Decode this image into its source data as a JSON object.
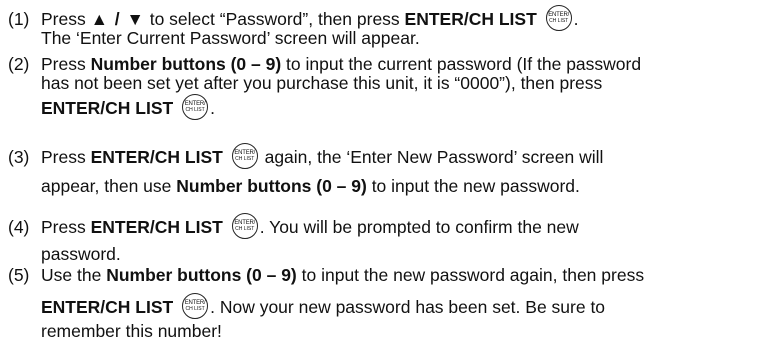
{
  "button": {
    "line1": "ENTER/",
    "line2": "CH LIST"
  },
  "steps": [
    {
      "num": "(1)",
      "parts": {
        "a": "Press ",
        "arrows": "▲ / ▼",
        "b": " to select “Password”, then press ",
        "bold1": "ENTER/CH LIST",
        "c": ".",
        "line2": "The ‘Enter Current Password’ screen will appear."
      }
    },
    {
      "num": "(2)",
      "parts": {
        "a": "Press ",
        "bold1": "Number buttons (0 – 9)",
        "b": " to input the current password (If the password",
        "line2": "has not been set yet after you purchase this unit, it is “0000”), then press",
        "bold2": "ENTER/CH LIST",
        "c": "."
      }
    },
    {
      "num": "(3)",
      "parts": {
        "a": "Press ",
        "bold1": "ENTER/CH LIST",
        "b": " again, the ‘Enter New Password’ screen will",
        "line2a": "appear, then use ",
        "bold2": "Number buttons (0 – 9)",
        "line2b": " to input the new password."
      }
    },
    {
      "num": "(4)",
      "parts": {
        "a": "Press ",
        "bold1": "ENTER/CH LIST",
        "b": ". You will be prompted to confirm the new",
        "line2": "password."
      }
    },
    {
      "num": "(5)",
      "parts": {
        "a": "Use the ",
        "bold1": "Number buttons (0 – 9)",
        "b": " to input the new password again, then press",
        "bold2": "ENTER/CH LIST",
        "c": ". Now your new password has been set. Be sure to",
        "line3": "remember this number!"
      }
    }
  ]
}
